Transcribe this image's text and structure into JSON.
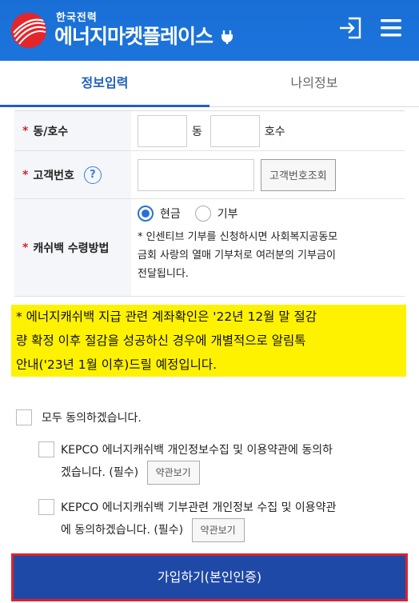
{
  "header": {
    "brand_small": "한국전력",
    "brand_large": "에너지마켓플레이스 ",
    "brand_suffix_icon": "power-plug-icon",
    "logo_icon": "kepco-logo-icon",
    "login_icon": "login-icon",
    "menu_icon": "hamburger-menu-icon",
    "color": "#1b72da"
  },
  "tabs": [
    {
      "label": "정보입력",
      "active": true
    },
    {
      "label": "나의정보",
      "active": false
    }
  ],
  "form": {
    "address": {
      "label": "동/호수",
      "dong_value": "",
      "dong_unit": "동",
      "ho_value": "",
      "ho_unit": "호수"
    },
    "customer_no": {
      "label": "고객번호",
      "help_glyph": "?",
      "value": "",
      "lookup_button": "고객번호조회"
    },
    "cashback_method": {
      "label": "캐쉬백 수령방법",
      "options": [
        "현금",
        "기부"
      ],
      "selected": "현금",
      "note_lines": [
        "* 인센티브 기부를 신청하시면 사회복지공동모",
        "금회 사랑의 열매 기부처로 여러분의 기부금이",
        "전달됩니다."
      ]
    }
  },
  "notice": {
    "lines": [
      "* 에너지캐쉬백 지급 관련 계좌확인은 '22년 12월 말 절감",
      "량 확정 이후 절감을 성공하신 경우에 개별적으로 알림톡",
      "안내('23년 1월 이후)드릴 예정입니다."
    ],
    "color": "#fff200"
  },
  "agreements": {
    "all_label": "모두 동의하겠습니다.",
    "items": [
      {
        "line1": "KEPCO 에너지캐쉬백 개인정보수집 및 이용약관에 동의하",
        "line2": "겠습니다. (필수)",
        "button": "약관보기"
      },
      {
        "line1": "KEPCO 에너지캐쉬백 기부관련 개인정보 수집 및 이용약관",
        "line2": "에 동의하겠습니다. (필수)",
        "button": "약관보기"
      }
    ]
  },
  "submit": {
    "label": "가입하기(본인인증)",
    "color": "#1f49a7",
    "highlight_color": "#d9232b"
  }
}
